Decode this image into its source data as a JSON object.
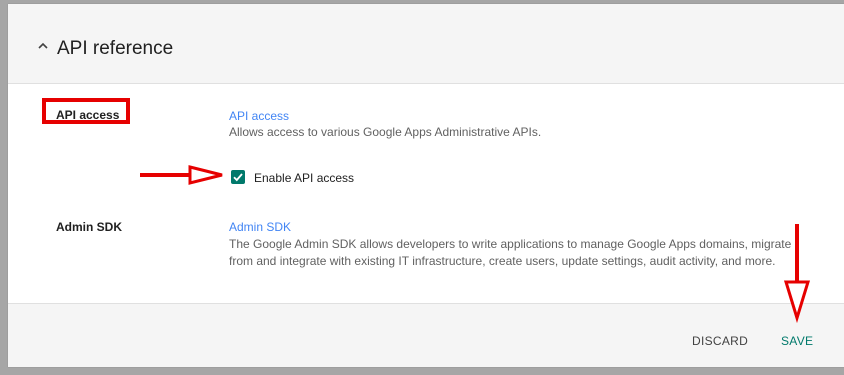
{
  "section": {
    "title": "API reference",
    "icon": "chevron-up-icon"
  },
  "rows": [
    {
      "label": "API access",
      "link_title": "API access",
      "description": "Allows access to various Google Apps Administrative APIs.",
      "checkbox": {
        "label": "Enable API access",
        "checked": true
      }
    },
    {
      "label": "Admin SDK",
      "link_title": "Admin SDK",
      "description": "The Google Admin SDK allows developers to write applications to manage Google Apps domains, migrate from and integrate with existing IT infrastructure, create users, update settings, audit activity, and more."
    }
  ],
  "footer": {
    "discard_label": "DISCARD",
    "save_label": "SAVE"
  },
  "colors": {
    "accent_teal": "#00796b",
    "link_blue": "#4285f4",
    "annotation_red": "#e60000"
  }
}
